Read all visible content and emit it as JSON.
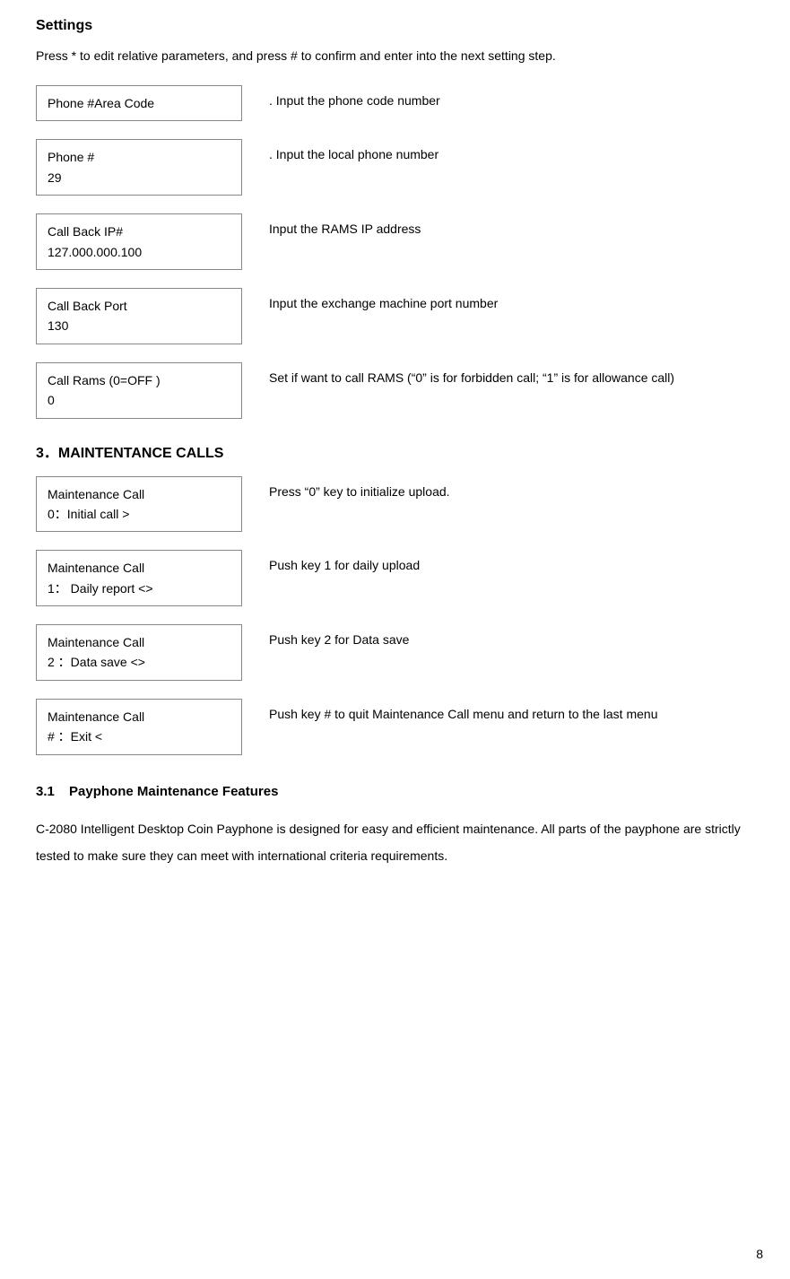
{
  "page": {
    "title": "Settings",
    "intro": "Press * to edit relative parameters, and press # to confirm and enter into the next setting step.",
    "page_number": "8"
  },
  "settings": [
    {
      "box_line1": "Phone #Area Code",
      "box_line2": "",
      "desc": ". Input the phone code number"
    },
    {
      "box_line1": "Phone #",
      "box_line2": "29",
      "desc": ". Input the local phone number"
    },
    {
      "box_line1": "Call    Back    IP#",
      "box_line2": "127.000.000.100",
      "desc": "Input the RAMS IP address"
    },
    {
      "box_line1": "Call    Back    Port",
      "box_line2": "130",
      "desc": "Input the exchange machine port number"
    },
    {
      "box_line1": "Call    Rams (0=OFF )",
      "box_line2": "0",
      "desc": "Set if want to call RAMS (“0” is for forbidden call; “1” is for allowance call)"
    }
  ],
  "section3": {
    "header": "3．MAINTENTANCE CALLS",
    "items": [
      {
        "box_line1": "Maintenance    Call",
        "box_line2": "0：Initial    call    >",
        "desc": "Press “0” key to initialize upload."
      },
      {
        "box_line1": "Maintenance    Call",
        "box_line2": "1：  Daily    report    <>",
        "desc": "Push key 1 for daily upload"
      },
      {
        "box_line1": "Maintenance Call",
        "box_line2": "2 ：Data    save      <>",
        "desc": "Push key 2 for Data save"
      },
      {
        "box_line1": "Maintenance Call",
        "box_line2": "#  ：Exit        <",
        "desc": "Push key # to quit Maintenance Call menu and return to the last menu"
      }
    ]
  },
  "section31": {
    "header": "3.1",
    "header_label": "Payphone Maintenance Features",
    "body": "C-2080 Intelligent Desktop Coin Payphone is designed for easy and efficient maintenance. All parts of the payphone are strictly tested to make sure they can meet with international criteria requirements."
  }
}
